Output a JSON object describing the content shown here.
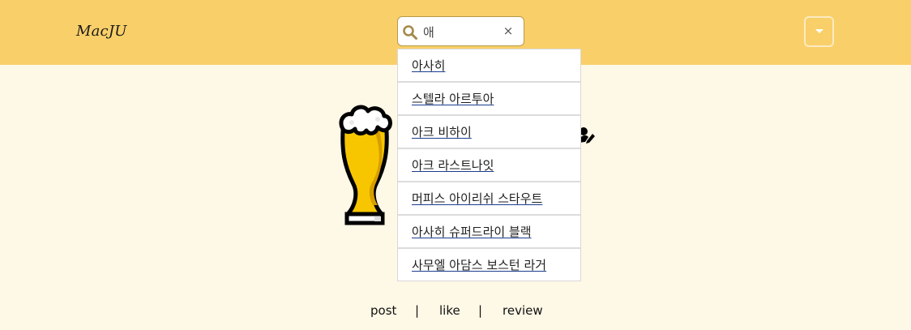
{
  "header": {
    "logo": "MacJU",
    "search": {
      "value": "애",
      "clear_symbol": "×"
    }
  },
  "dropdown": {
    "items": [
      "아사히",
      "스텔라 아르투아",
      "아크 비하이",
      "아크 라스트나잇",
      "머피스 아이리쉬 스타우트",
      "아사히 슈퍼드라이 블랙",
      "사무엘 아담스 보스턴 라거"
    ]
  },
  "icons": {
    "search": "search-icon",
    "clear": "close-icon",
    "menu": "chevron-down-icon",
    "beer": "beer-glass-icon",
    "edit": "pencil-icon"
  },
  "footer": {
    "links": [
      "post",
      "like",
      "review"
    ],
    "separator": "|"
  },
  "colors": {
    "header_bg": "#F9CF69",
    "page_bg": "#FEF8E6",
    "beer": "#F7C600",
    "foam": "#FFFFFF"
  }
}
